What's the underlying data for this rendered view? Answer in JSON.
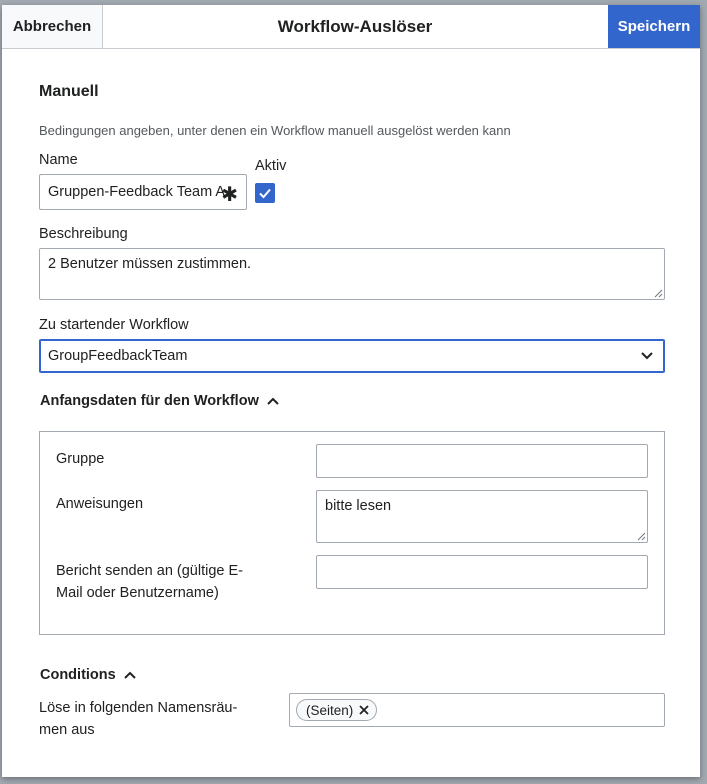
{
  "dialog": {
    "title": "Workflow-Auslöser",
    "cancel_label": "Abbrechen",
    "save_label": "Speichern"
  },
  "section": {
    "title": "Manuell",
    "help": "Bedingungen angeben, unter denen ein Workflow manuell ausgelöst werden kann"
  },
  "fields": {
    "name_label": "Name",
    "name_value": "Gruppen-Feedback Team A",
    "active_label": "Aktiv",
    "active_checked": true,
    "description_label": "Beschreibung",
    "description_value": "2 Benutzer müssen zustimmen.",
    "workflow_label": "Zu startender Workflow",
    "workflow_value": "GroupFeedbackTeam"
  },
  "initial_data": {
    "title": "Anfangsdaten für den Workflow",
    "group_label": "Gruppe",
    "group_value": "",
    "instructions_label": "Anweisungen",
    "instructions_value": "bitte lesen",
    "report_label_line1": "Bericht senden an (gültige E-",
    "report_label_line2": "Mail oder Benutzername)",
    "report_value": ""
  },
  "conditions": {
    "title": "Conditions",
    "namespaces_label_line1": "Löse in folgenden Namensräu-",
    "namespaces_label_line2": "men aus",
    "namespace_tags": [
      "(Seiten)"
    ]
  },
  "colors": {
    "accent": "#3366cc",
    "border": "#a2a9b1"
  }
}
